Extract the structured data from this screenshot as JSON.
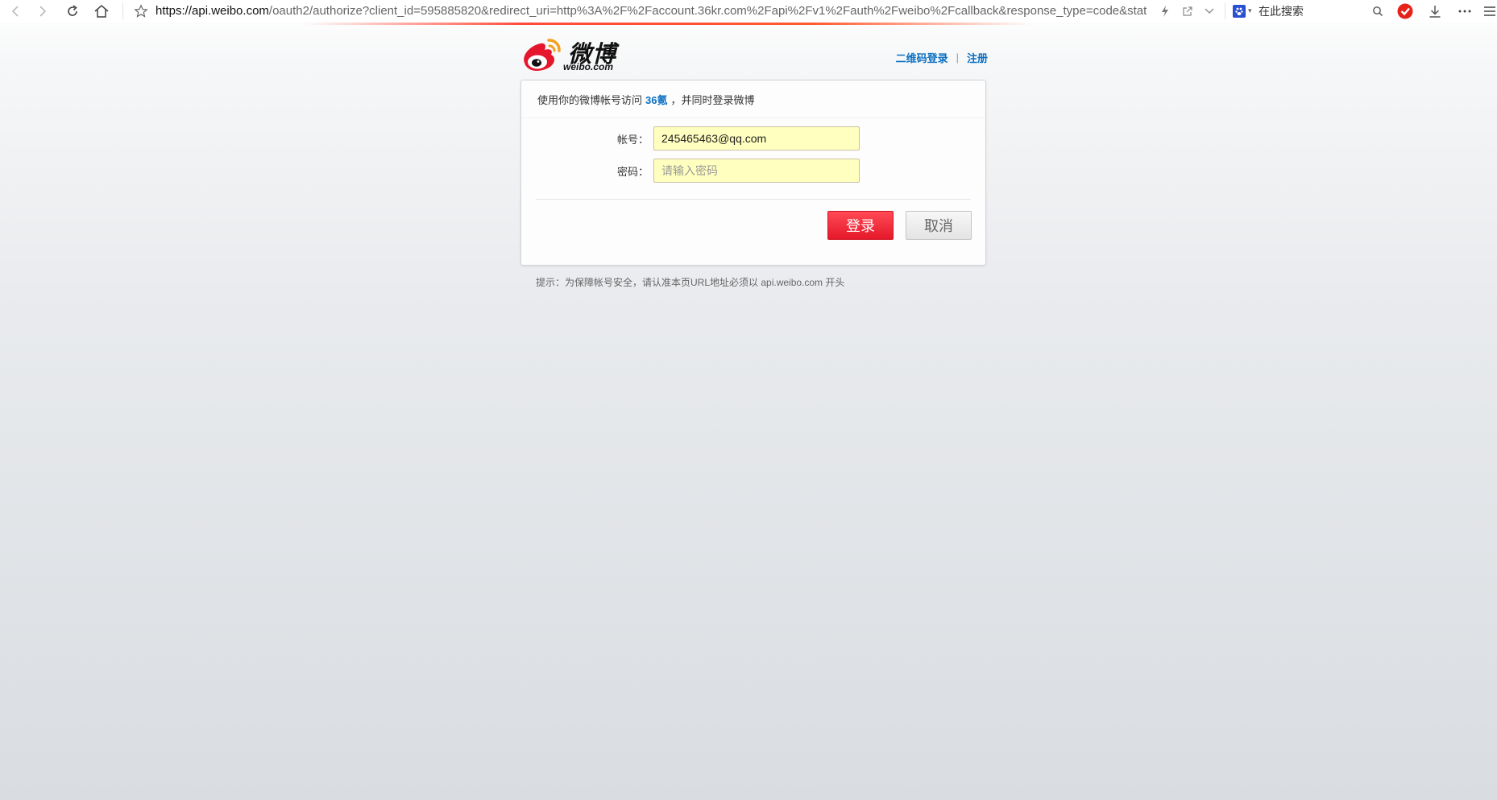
{
  "browser": {
    "url_host": "https://api.weibo.com",
    "url_rest": "/oauth2/authorize?client_id=595885820&redirect_uri=http%3A%2F%2Faccount.36kr.com%2Fapi%2Fv1%2Fauth%2Fweibo%2Fcallback&response_type=code&stat",
    "search_placeholder": "在此搜索",
    "accent_color": "#ff4a3a"
  },
  "logo": {
    "name": "微博",
    "domain": "weibo.com"
  },
  "top_links": {
    "qr_login": "二维码登录",
    "divider": "|",
    "register": "注册",
    "link_color": "#0a6fc2"
  },
  "card": {
    "intro_prefix": "使用你的微博帐号访问",
    "app_name": "36氪",
    "intro_suffix": "，并同时登录微博"
  },
  "form": {
    "account_label": "帐号：",
    "account_value": "245465463@qq.com",
    "password_label": "密码：",
    "password_placeholder": "请输入密码"
  },
  "buttons": {
    "login": "登录",
    "cancel": "取消",
    "login_color": "#e5182a"
  },
  "tip": "提示：为保障帐号安全，请认准本页URL地址必须以 api.weibo.com 开头"
}
